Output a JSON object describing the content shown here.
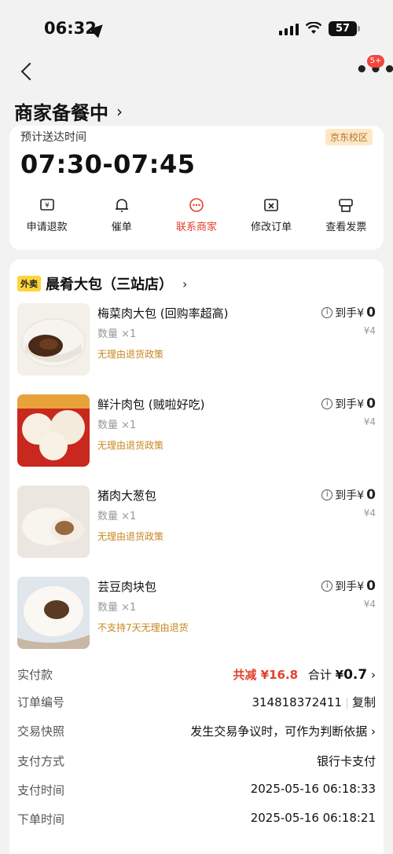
{
  "status_bar": {
    "time": "06:32",
    "battery": "57"
  },
  "header": {
    "title": "商家备餐中",
    "title_chevron": "›",
    "more_badge": "5+"
  },
  "delivery": {
    "label": "预计送达时间",
    "school_tag": "京东校区",
    "time_range": "07:30-07:45"
  },
  "actions": [
    {
      "label": "申请退款",
      "icon": "refund-icon"
    },
    {
      "label": "催单",
      "icon": "bell-icon"
    },
    {
      "label": "联系商家",
      "icon": "chat-icon"
    },
    {
      "label": "修改订单",
      "icon": "edit-order-icon"
    },
    {
      "label": "查看发票",
      "icon": "invoice-icon"
    }
  ],
  "store": {
    "tag": "外卖",
    "name": "晨肴大包（三站店）",
    "chevron": "›"
  },
  "items": [
    {
      "name": "梅菜肉大包 (回购率超高)",
      "qty": "数量 ×1",
      "policy": "无理由退货政策",
      "get_label": "到手¥",
      "get_value": "0",
      "price": "¥4"
    },
    {
      "name": "鲜汁肉包 (贼啦好吃)",
      "qty": "数量 ×1",
      "policy": "无理由退货政策",
      "get_label": "到手¥",
      "get_value": "0",
      "price": "¥4"
    },
    {
      "name": "猪肉大葱包",
      "qty": "数量 ×1",
      "policy": "无理由退货政策",
      "get_label": "到手¥",
      "get_value": "0",
      "price": "¥4"
    },
    {
      "name": "芸豆肉块包",
      "qty": "数量 ×1",
      "policy": "不支持7天无理由退货",
      "get_label": "到手¥",
      "get_value": "0",
      "price": "¥4"
    }
  ],
  "summary": {
    "paid_label": "实付款",
    "discount": "共减 ¥16.8",
    "total_label": "合计",
    "total_currency": "¥",
    "total_value": "0.7",
    "total_chevron": "›"
  },
  "order_info": {
    "order_no_label": "订单编号",
    "order_no": "314818372411",
    "copy_label": "复制",
    "snapshot_label": "交易快照",
    "snapshot_value": "发生交易争议时，可作为判断依据",
    "snapshot_chevron": "›",
    "pay_method_label": "支付方式",
    "pay_method": "银行卡支付",
    "pay_time_label": "支付时间",
    "pay_time": "2025-05-16 06:18:33",
    "order_time_label": "下单时间",
    "order_time": "2025-05-16 06:18:21"
  },
  "colors": {
    "accent": "#e2412b",
    "policy": "#c8861f",
    "tag_yellow": "#ffd43b"
  }
}
